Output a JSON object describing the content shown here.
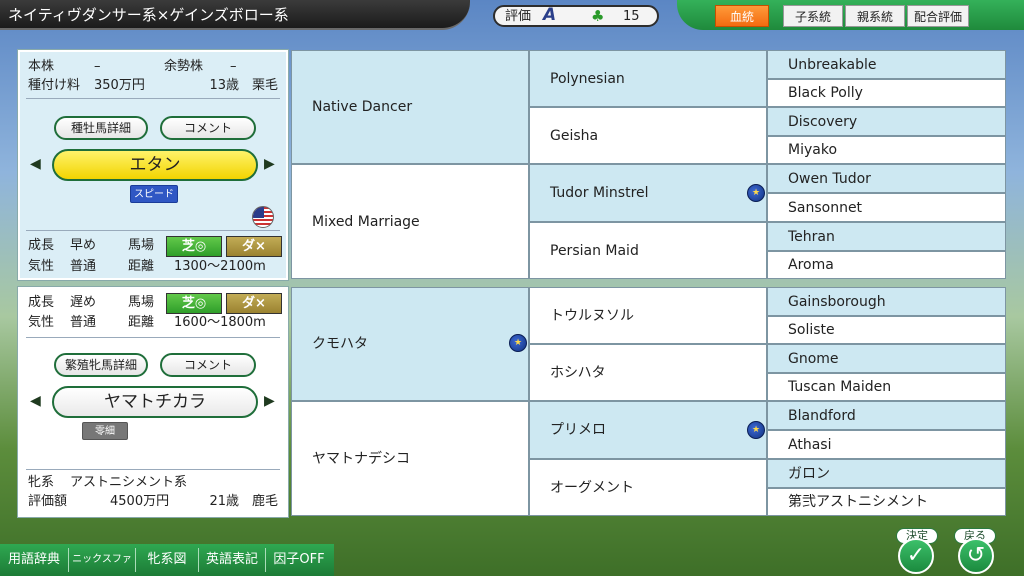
{
  "header": {
    "title": "ネイティヴダンサー系×ゲインズボロー系",
    "rating_label": "評価",
    "rating_grade": "A",
    "clover_count": "15",
    "tabs": [
      {
        "label": "血統",
        "active": true
      },
      {
        "label": "子系統",
        "active": false
      },
      {
        "label": "親系統",
        "active": false
      },
      {
        "label": "配合評価",
        "active": false
      }
    ]
  },
  "sire_panel": {
    "honkabu_label": "本株",
    "honkabu_value": "–",
    "yoseikabu_label": "余勢株",
    "yoseikabu_value": "–",
    "fee_label": "種付け料",
    "fee_value": "350万円",
    "age_coat": "13歳　栗毛",
    "detail_button": "種牡馬詳細",
    "comment_button": "コメント",
    "name": "エタン",
    "tag": "スピード",
    "flag": "us-flag",
    "growth_label": "成長",
    "growth_value": "早め",
    "temper_label": "気性",
    "temper_value": "普通",
    "track_label": "馬場",
    "turf": "芝◎",
    "dirt": "ダ×",
    "distance_label": "距離",
    "distance_value": "1300〜2100m"
  },
  "dam_panel": {
    "growth_label": "成長",
    "growth_value": "遅め",
    "temper_label": "気性",
    "temper_value": "普通",
    "track_label": "馬場",
    "turf": "芝◎",
    "dirt": "ダ×",
    "distance_label": "距離",
    "distance_value": "1600〜1800m",
    "detail_button": "繁殖牝馬詳細",
    "comment_button": "コメント",
    "name": "ヤマトチカラ",
    "tag": "零細",
    "line_label": "牝系",
    "line_value": "アストニシメント系",
    "value_label": "評価額",
    "value_value": "4500万円",
    "age_coat": "21歳　鹿毛"
  },
  "pedigree": {
    "gen1": [
      "Native Dancer",
      "Mixed Marriage",
      "クモハタ",
      "ヤマトナデシコ"
    ],
    "gen2": [
      "Polynesian",
      "Geisha",
      "Tudor Minstrel",
      "Persian Maid",
      "トウルヌソル",
      "ホシハタ",
      "プリメロ",
      "オーグメント"
    ],
    "gen3": [
      "Unbreakable",
      "Black Polly",
      "Discovery",
      "Miyako",
      "Owen Tudor",
      "Sansonnet",
      "Tehran",
      "Aroma",
      "Gainsborough",
      "Soliste",
      "Gnome",
      "Tuscan Maiden",
      "Blandford",
      "Athasi",
      "ガロン",
      "第弐アストニシメント"
    ]
  },
  "bottom": {
    "items": [
      "用語辞典",
      "ニックスファイル",
      "牝系図",
      "英語表記",
      "因子OFF"
    ],
    "confirm_label": "決定",
    "back_label": "戻る"
  }
}
